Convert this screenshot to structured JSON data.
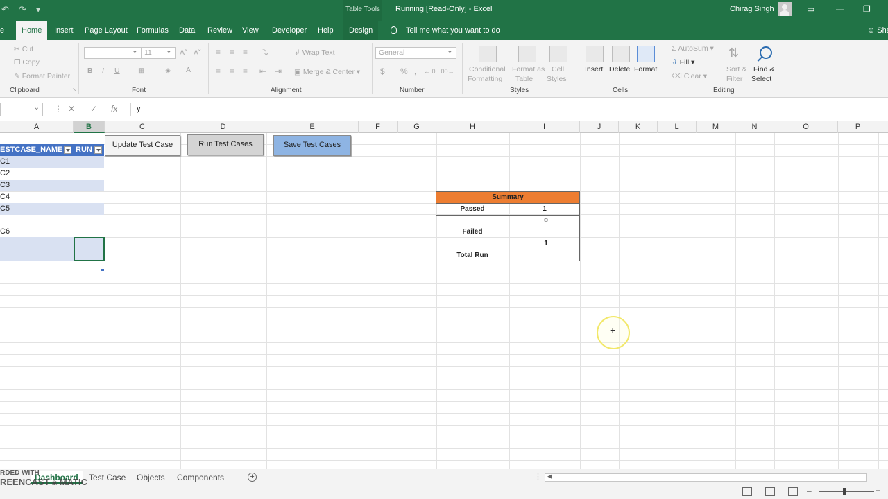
{
  "titlebar": {
    "context_tab": "Table Tools",
    "title": "Running  [Read-Only]  -  Excel",
    "user": "Chirag Singh"
  },
  "tabs": [
    "Home",
    "Insert",
    "Page Layout",
    "Formulas",
    "Data",
    "Review",
    "View",
    "Developer",
    "Help",
    "Design"
  ],
  "tell_me": "Tell me what you want to do",
  "share": "Sha",
  "ribbon": {
    "clipboard": {
      "cut": "Cut",
      "copy": "Copy",
      "format_painter": "Format Painter",
      "label": "Clipboard"
    },
    "font": {
      "size": "11",
      "label": "Font",
      "bold": "B",
      "italic": "I",
      "underline": "U"
    },
    "alignment": {
      "wrap": "Wrap Text",
      "merge": "Merge & Center",
      "label": "Alignment"
    },
    "number": {
      "format": "General",
      "label": "Number",
      "currency": "$",
      "percent": "%"
    },
    "styles": {
      "conditional": "Conditional",
      "conditional2": "Formatting",
      "format_as": "Format as",
      "format_as2": "Table",
      "cell": "Cell",
      "cell2": "Styles",
      "label": "Styles"
    },
    "cells": {
      "insert": "Insert",
      "delete": "Delete",
      "format": "Format",
      "label": "Cells"
    },
    "editing": {
      "autosum": "AutoSum",
      "fill": "Fill",
      "clear": "Clear",
      "sort": "Sort &",
      "sort2": "Filter",
      "find": "Find &",
      "find2": "Select",
      "label": "Editing"
    }
  },
  "formula": {
    "value": "y",
    "fx": "fx"
  },
  "columns": [
    "A",
    "B",
    "C",
    "D",
    "E",
    "F",
    "G",
    "H",
    "I",
    "J",
    "K",
    "L",
    "M",
    "N",
    "O",
    "P"
  ],
  "table": {
    "header_a": "ESTCASE_NAME",
    "header_b": "RUN",
    "rows": [
      "C1",
      "C2",
      "C3",
      "C4",
      "C5",
      "C6"
    ]
  },
  "buttons": {
    "update": "Update Test Case",
    "run": "Run Test Cases",
    "save": "Save Test Cases"
  },
  "summary": {
    "title": "Summary",
    "passed_label": "Passed",
    "passed_value": "1",
    "failed_label": "Failed",
    "failed_value": "0",
    "total_label": "Total Run",
    "total_value": "1"
  },
  "sheets": [
    "Dashboard",
    "Test Case",
    "Objects",
    "Components"
  ],
  "watermark": {
    "line1": "RDED WITH",
    "line2": "REENCAST",
    "line3": "MATIC"
  },
  "colors": {
    "excel_green": "#217346",
    "table_blue": "#4472c4",
    "band_blue": "#d9e1f2",
    "summary_orange": "#ed7d31"
  }
}
